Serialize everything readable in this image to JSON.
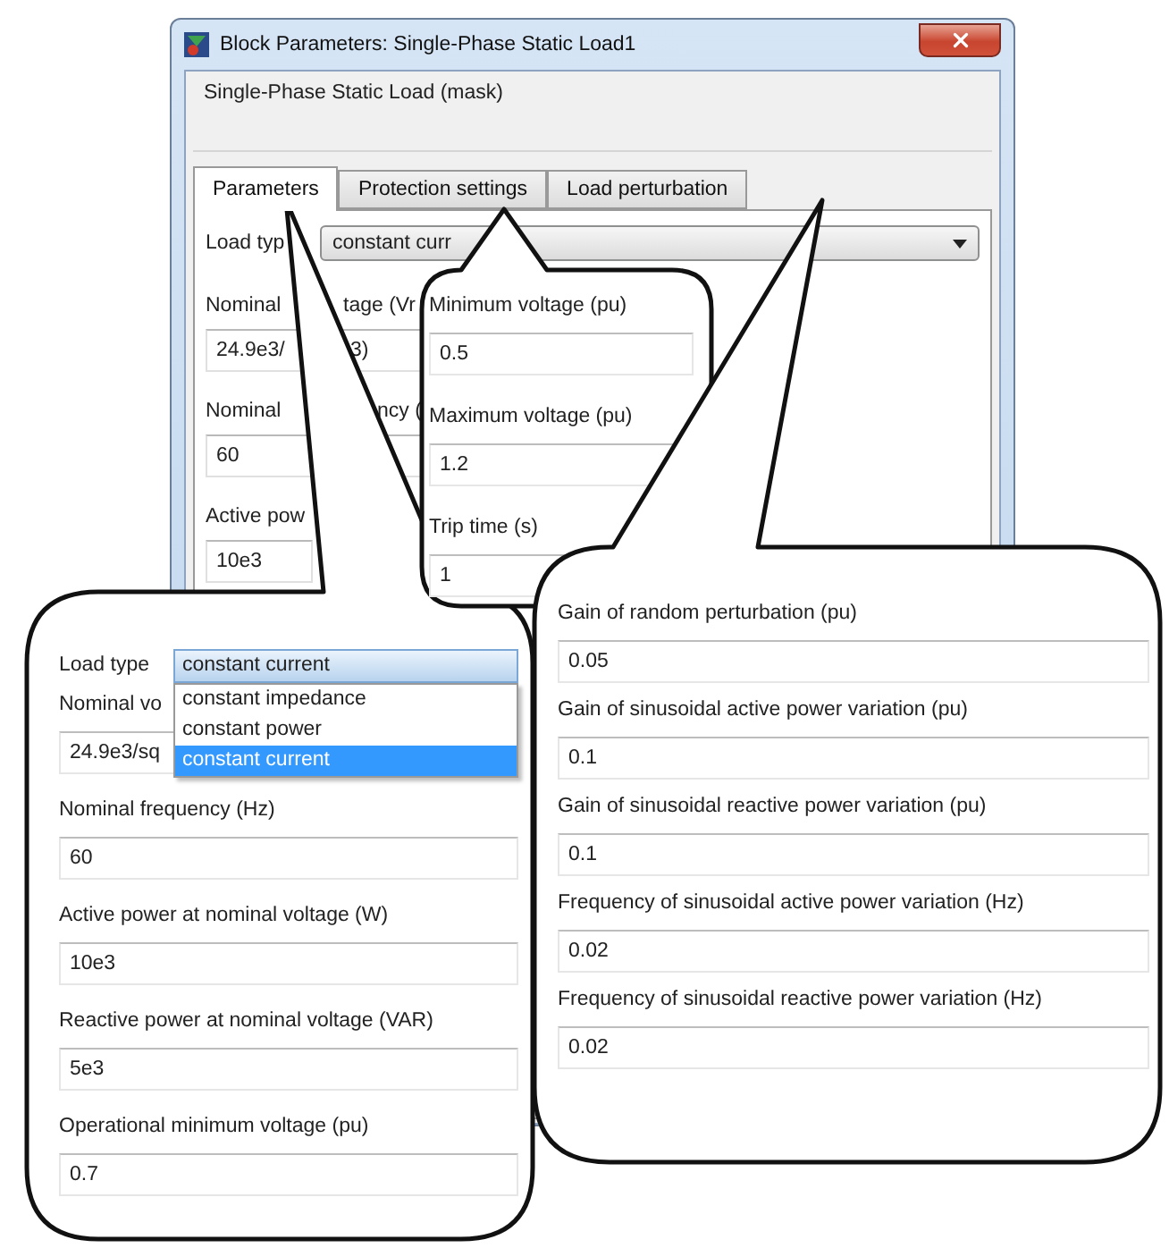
{
  "window": {
    "title": "Block Parameters: Single-Phase Static Load1"
  },
  "mask_title": "Single-Phase Static Load (mask)",
  "tabs": [
    {
      "label": "Parameters",
      "selected": true
    },
    {
      "label": "Protection settings",
      "selected": false
    },
    {
      "label": "Load perturbation",
      "selected": false
    }
  ],
  "parameters_tab": {
    "load_type": {
      "label": "Load typ",
      "value": "constant curr"
    },
    "rows": [
      {
        "kind": "label",
        "parts": [
          "Nominal",
          "tage (Vr"
        ]
      },
      {
        "kind": "field",
        "parts": [
          "24.9e3/",
          "3)"
        ]
      },
      {
        "kind": "label",
        "parts": [
          "Nominal",
          "ncy ("
        ]
      },
      {
        "kind": "field",
        "parts": [
          "60"
        ]
      },
      {
        "kind": "label",
        "parts": [
          "Active pow"
        ]
      },
      {
        "kind": "field",
        "parts": [
          "10e3"
        ]
      }
    ]
  },
  "parameters_callout": {
    "load_type": {
      "label": "Load type",
      "value": "constant current",
      "options": [
        {
          "label": "constant impedance",
          "selected": false
        },
        {
          "label": "constant power",
          "selected": false
        },
        {
          "label": "constant current",
          "selected": true
        }
      ]
    },
    "partial_field": {
      "label": "Nominal vo",
      "value": "24.9e3/sq"
    },
    "fields": [
      {
        "label": "Nominal frequency (Hz)",
        "value": "60"
      },
      {
        "label": "Active power at nominal voltage (W)",
        "value": "10e3"
      },
      {
        "label": "Reactive power at nominal voltage (VAR)",
        "value": "5e3"
      },
      {
        "label": "Operational minimum voltage (pu)",
        "value": "0.7"
      }
    ]
  },
  "protection_callout": {
    "fields": [
      {
        "label": "Minimum voltage (pu)",
        "value": "0.5"
      },
      {
        "label": "Maximum voltage (pu)",
        "value": "1.2"
      },
      {
        "label": "Trip time (s)",
        "value": "1"
      }
    ]
  },
  "perturbation_callout": {
    "fields": [
      {
        "label": "Gain of random perturbation (pu)",
        "value": "0.05"
      },
      {
        "label": "Gain of sinusoidal active power variation (pu)",
        "value": "0.1"
      },
      {
        "label": "Gain of sinusoidal reactive power variation (pu)",
        "value": "0.1"
      },
      {
        "label": "Frequency of sinusoidal active power variation (Hz)",
        "value": "0.02"
      },
      {
        "label": "Frequency of sinusoidal reactive power variation (Hz)",
        "value": "0.02"
      }
    ]
  }
}
